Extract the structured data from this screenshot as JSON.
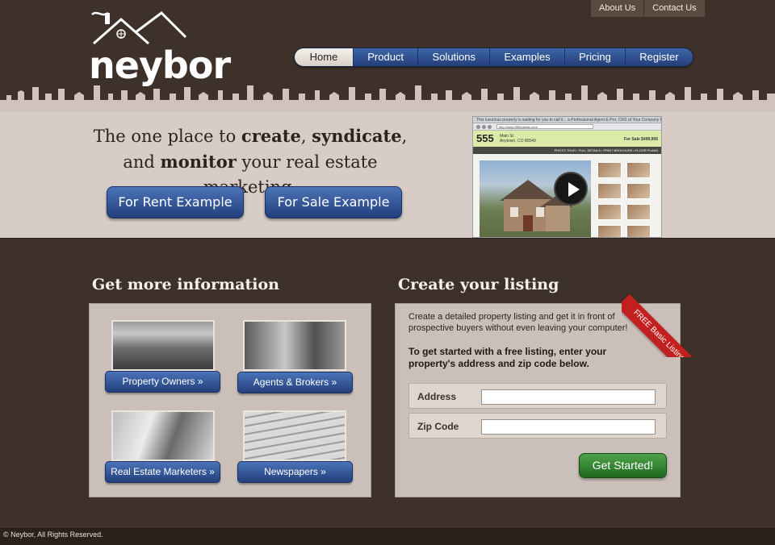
{
  "brand": {
    "name": "neybor"
  },
  "top_links": [
    "About Us",
    "Contact Us"
  ],
  "nav": {
    "items": [
      {
        "label": "Home",
        "active": true
      },
      {
        "label": "Product",
        "active": false
      },
      {
        "label": "Solutions",
        "active": false
      },
      {
        "label": "Examples",
        "active": false
      },
      {
        "label": "Pricing",
        "active": false
      },
      {
        "label": "Register",
        "active": false
      }
    ]
  },
  "hero": {
    "tagline_parts": [
      "The one place to ",
      "create",
      ", ",
      "syndicate",
      ", and ",
      "monitor",
      " your real estate marketing."
    ],
    "buttons": {
      "rent": "For Rent Example",
      "sale": "For Sale Example"
    },
    "preview": {
      "title": "This luxurious property is waiting for you to call it... a Professional Agent E-Pro, CRS of Your Company Name",
      "url": "http://www.555mainst.com/",
      "house_number": "555",
      "street": "Main St",
      "city": "Anytown, CO 80540",
      "price": "For Sale $499,995",
      "tabs": "PHOTO TOUR  •  FULL DETAILS  •  PRINT BROCHURE  •  FLOOR PLANS"
    }
  },
  "info": {
    "title": "Get more information",
    "cards": [
      {
        "label": "Property Owners »",
        "icon": "house-photo"
      },
      {
        "label": "Agents & Brokers »",
        "icon": "people-photo"
      },
      {
        "label": "Real Estate Marketers »",
        "icon": "office-photo"
      },
      {
        "label": "Newspapers »",
        "icon": "newspaper-photo"
      }
    ]
  },
  "listing": {
    "title": "Create your listing",
    "ribbon": "FREE Basic Listings",
    "intro": "Create a detailed property listing and get it in front of prospective buyers without even leaving your computer!",
    "cta": "To get started with a free listing, enter your property's address and zip code below.",
    "fields": [
      {
        "label": "Address",
        "value": ""
      },
      {
        "label": "Zip Code",
        "value": ""
      }
    ],
    "submit": "Get Started!"
  },
  "footer": {
    "text": "© Neybor, All Rights Reserved."
  },
  "colors": {
    "background": "#3e3129",
    "hero": "#d8ccc6",
    "panel": "#cbc0b9",
    "button_blue": "#2f52926",
    "button_green": "#2f7f2b",
    "ribbon_red": "#c21f1f"
  }
}
